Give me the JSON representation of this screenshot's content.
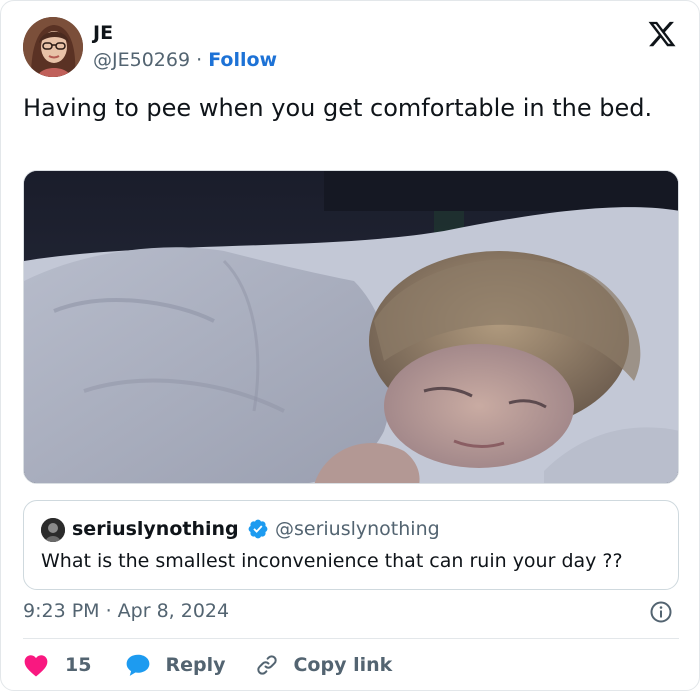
{
  "author": {
    "name": "JE",
    "handle": "@JE50269",
    "separator": "·",
    "follow_label": "Follow",
    "avatar_icon": "profile-photo"
  },
  "brand": {
    "icon": "x-logo-icon",
    "color": "#0f1419"
  },
  "tweet": {
    "text": "Having to pee when you get comfortable in the bed.",
    "media_description_icon": "sleeping-woman-photo"
  },
  "quote": {
    "name": "seriuslynothing",
    "verified_icon": "verified-badge-icon",
    "verified_color": "#1d9bf0",
    "handle": "@seriuslynothing",
    "text": "What is the smallest inconvenience that can ruin your day ??"
  },
  "meta": {
    "timestamp": "9:23 PM · Apr 8, 2024",
    "info_icon": "info-icon"
  },
  "actions": {
    "like_count": "15",
    "like_color": "#f91880",
    "reply_label": "Reply",
    "reply_color": "#1d9bf0",
    "copy_label": "Copy link"
  },
  "colors": {
    "link": "#1d72d6",
    "secondary_text": "#536471",
    "primary_text": "#0f1419"
  }
}
